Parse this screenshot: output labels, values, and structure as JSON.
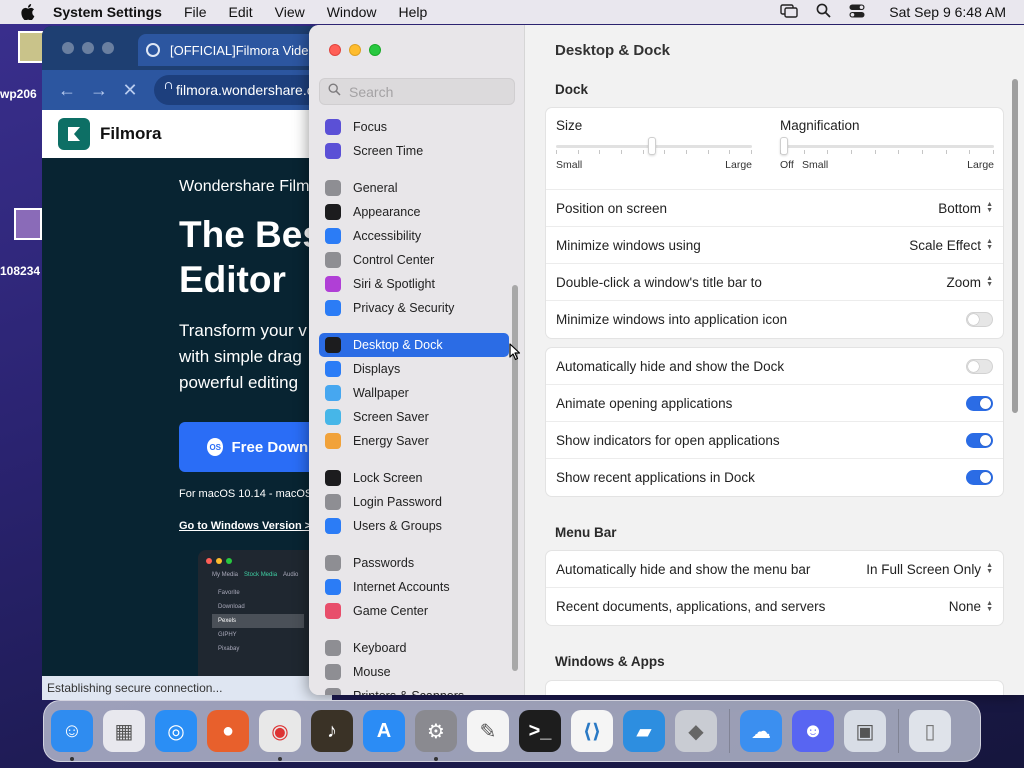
{
  "menubar": {
    "app_name": "System Settings",
    "menus": [
      "File",
      "Edit",
      "View",
      "Window",
      "Help"
    ],
    "clock": "Sat Sep 9  6:48 AM"
  },
  "desktop": {
    "labels": [
      "wp206",
      "108234"
    ]
  },
  "browser": {
    "tab_title": "[OFFICIAL]Filmora Video Editor",
    "url": "filmora.wondershare.com",
    "brand": "Filmora",
    "eyebrow": "Wondershare Filmora",
    "headline_1": "The Best",
    "headline_2": "Editor",
    "sub_1": "Transform your v",
    "sub_2": "with simple drag",
    "sub_3": "powerful editing",
    "cta": "Free Download",
    "note": "For macOS 10.14 - macOS",
    "windows_link": "Go to Windows Version >",
    "mock_tabs": [
      "My Media",
      "Stock Media",
      "Audio"
    ],
    "mock_items": [
      "Favorite",
      "Download",
      "Pexels",
      "GIPHY",
      "Pixabay"
    ],
    "status": "Establishing secure connection..."
  },
  "settings": {
    "search_placeholder": "Search",
    "sidebar_groups": [
      [
        {
          "label": "Focus",
          "icon": "moon-icon",
          "color": "#5b50d6"
        },
        {
          "label": "Screen Time",
          "icon": "hourglass-icon",
          "color": "#5b50d6"
        }
      ],
      [
        {
          "label": "General",
          "icon": "gear-icon",
          "color": "#8e8e93"
        },
        {
          "label": "Appearance",
          "icon": "appearance-icon",
          "color": "#1c1c1e"
        },
        {
          "label": "Accessibility",
          "icon": "accessibility-icon",
          "color": "#2b7cf6"
        },
        {
          "label": "Control Center",
          "icon": "control-center-icon",
          "color": "#8e8e93"
        },
        {
          "label": "Siri & Spotlight",
          "icon": "siri-icon",
          "color": "#b03fd6"
        },
        {
          "label": "Privacy & Security",
          "icon": "hand-icon",
          "color": "#2b7cf6"
        }
      ],
      [
        {
          "label": "Desktop & Dock",
          "icon": "dock-icon",
          "color": "#1c1c1e",
          "selected": true
        },
        {
          "label": "Displays",
          "icon": "display-icon",
          "color": "#2b7cf6"
        },
        {
          "label": "Wallpaper",
          "icon": "wallpaper-icon",
          "color": "#46a7f0"
        },
        {
          "label": "Screen Saver",
          "icon": "screen-saver-icon",
          "color": "#46b6e8"
        },
        {
          "label": "Energy Saver",
          "icon": "battery-icon",
          "color": "#f1a23a"
        }
      ],
      [
        {
          "label": "Lock Screen",
          "icon": "lock-screen-icon",
          "color": "#1c1c1e"
        },
        {
          "label": "Login Password",
          "icon": "lock-icon",
          "color": "#8e8e93"
        },
        {
          "label": "Users & Groups",
          "icon": "users-icon",
          "color": "#2b7cf6"
        }
      ],
      [
        {
          "label": "Passwords",
          "icon": "key-icon",
          "color": "#8e8e93"
        },
        {
          "label": "Internet Accounts",
          "icon": "at-icon",
          "color": "#2b7cf6"
        },
        {
          "label": "Game Center",
          "icon": "game-center-icon",
          "color": "#e84e6b"
        }
      ],
      [
        {
          "label": "Keyboard",
          "icon": "keyboard-icon",
          "color": "#8e8e93"
        },
        {
          "label": "Mouse",
          "icon": "mouse-icon",
          "color": "#8e8e93"
        },
        {
          "label": "Printers & Scanners",
          "icon": "printer-icon",
          "color": "#8e8e93"
        }
      ]
    ],
    "page_title": "Desktop & Dock",
    "dock_heading": "Dock",
    "size": {
      "label": "Size",
      "min": "Small",
      "max": "Large",
      "value": 0.49
    },
    "magnification": {
      "label": "Magnification",
      "off": "Off",
      "min": "Small",
      "max": "Large",
      "value": 0.0
    },
    "dock_rows": [
      {
        "label": "Position on screen",
        "value": "Bottom"
      },
      {
        "label": "Minimize windows using",
        "value": "Scale Effect"
      },
      {
        "label": "Double-click a window's title bar to",
        "value": "Zoom"
      },
      {
        "label": "Minimize windows into application icon",
        "toggle": false
      }
    ],
    "dock_toggles": [
      {
        "label": "Automatically hide and show the Dock",
        "toggle": false
      },
      {
        "label": "Animate opening applications",
        "toggle": true
      },
      {
        "label": "Show indicators for open applications",
        "toggle": true
      },
      {
        "label": "Show recent applications in Dock",
        "toggle": true
      }
    ],
    "menu_bar_heading": "Menu Bar",
    "menu_bar_rows": [
      {
        "label": "Automatically hide and show the menu bar",
        "value": "In Full Screen Only"
      },
      {
        "label": "Recent documents, applications, and servers",
        "value": "None"
      }
    ],
    "windows_apps_heading": "Windows & Apps"
  },
  "dock_apps": [
    {
      "name": "Finder",
      "icon": "finder-icon",
      "color": "#2f8cf0",
      "running": true
    },
    {
      "name": "Launchpad",
      "icon": "launchpad-icon",
      "color": "#e8e8ee",
      "running": false
    },
    {
      "name": "Safari",
      "icon": "safari-icon",
      "color": "#2a8ef5",
      "running": false
    },
    {
      "name": "Firefox",
      "icon": "firefox-icon",
      "color": "#e8602c",
      "running": false
    },
    {
      "name": "Chrome",
      "icon": "chrome-icon",
      "color": "#e8e8e8",
      "running": true
    },
    {
      "name": "GarageBand",
      "icon": "guitar-icon",
      "color": "#3a3226",
      "running": false
    },
    {
      "name": "App Store",
      "icon": "app-store-icon",
      "color": "#2b8cf5",
      "running": false
    },
    {
      "name": "System Settings",
      "icon": "gear-icon",
      "color": "#8a8a90",
      "running": true
    },
    {
      "name": "TextEdit",
      "icon": "textedit-icon",
      "color": "#f4f4f4",
      "running": false
    },
    {
      "name": "Terminal",
      "icon": "terminal-icon",
      "color": "#1d1d1d",
      "running": false
    },
    {
      "name": "VS Code",
      "icon": "vscode-icon",
      "color": "#f5f5f5",
      "running": false
    },
    {
      "name": "Filmora",
      "icon": "filmora-icon",
      "color": "#2d8ee0",
      "running": false
    },
    {
      "name": "Roblox",
      "icon": "roblox-icon",
      "color": "#c9ccd3",
      "running": false
    },
    {
      "name": "Weather",
      "icon": "weather-icon",
      "color": "#3b8ff0",
      "running": false
    },
    {
      "name": "Discord",
      "icon": "discord-icon",
      "color": "#5865f2",
      "running": false
    },
    {
      "name": "Preview",
      "icon": "preview-icon",
      "color": "#d8dde6",
      "running": false
    },
    {
      "name": "Trash",
      "icon": "trash-icon",
      "color": "#dfe3ea",
      "running": false
    }
  ]
}
